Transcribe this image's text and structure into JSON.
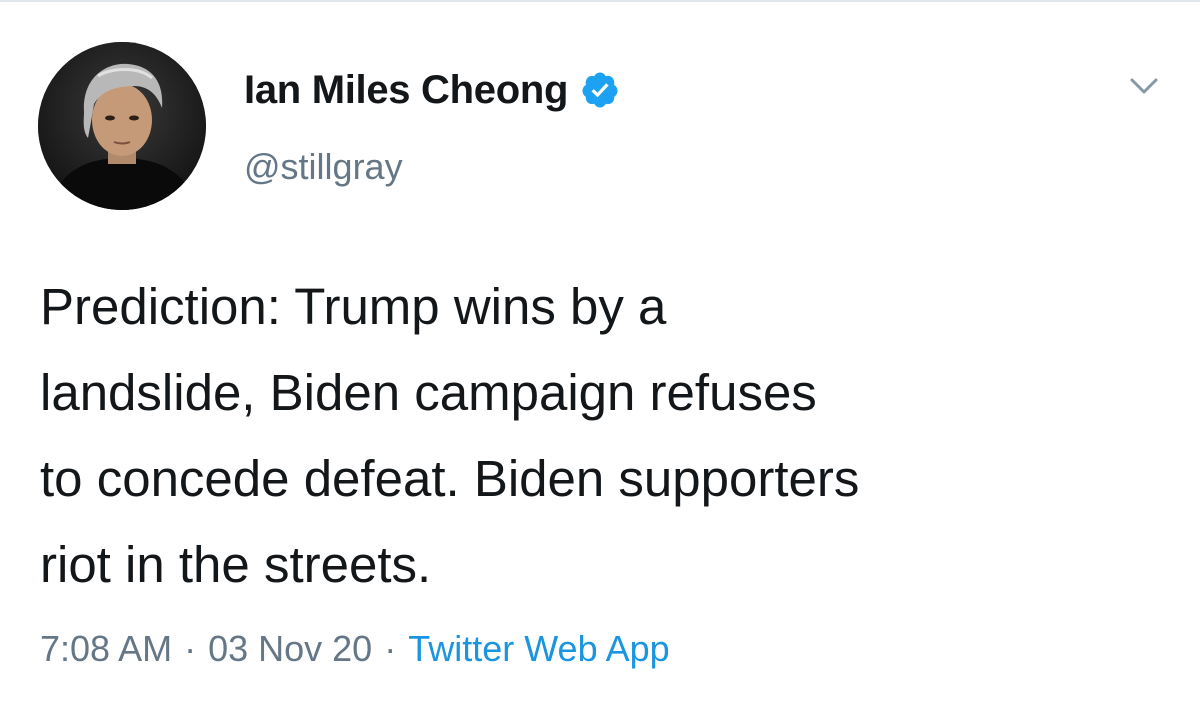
{
  "user": {
    "display_name": "Ian Miles Cheong",
    "handle": "@stillgray",
    "verified_icon": "verified-badge-icon",
    "avatar_icon": "profile-photo"
  },
  "tweet": {
    "lines": [
      "Prediction: Trump wins by a",
      "landslide, Biden campaign refuses",
      "to concede defeat. Biden supporters",
      "riot in the streets."
    ]
  },
  "meta": {
    "time": "7:08 AM",
    "separator": "·",
    "date": "03 Nov 20",
    "source": "Twitter Web App"
  },
  "menu": {
    "icon": "chevron-down-icon"
  },
  "colors": {
    "text": "#14171a",
    "secondary": "#657786",
    "accent": "#1b95e0",
    "verified": "#1da1f2"
  }
}
